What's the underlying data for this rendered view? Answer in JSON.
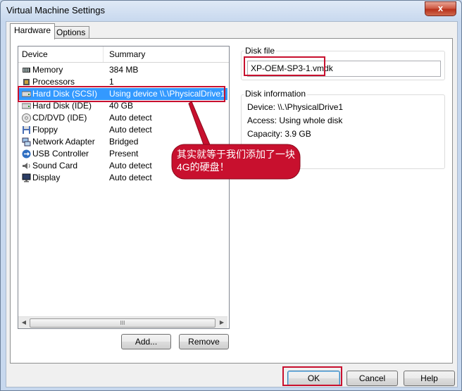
{
  "window": {
    "title": "Virtual Machine Settings",
    "close_label": "x"
  },
  "tabs": [
    {
      "label": "Hardware"
    },
    {
      "label": "Options"
    }
  ],
  "device_list": {
    "columns": {
      "device": "Device",
      "summary": "Summary"
    },
    "rows": [
      {
        "device": "Memory",
        "summary": "384 MB",
        "icon": "memory-icon"
      },
      {
        "device": "Processors",
        "summary": "1",
        "icon": "processor-icon"
      },
      {
        "device": "Hard Disk (SCSI)",
        "summary": "Using device \\\\.\\PhysicalDrive1",
        "icon": "hard-disk-icon",
        "selected": true
      },
      {
        "device": "Hard Disk (IDE)",
        "summary": "40 GB",
        "icon": "hard-disk-icon"
      },
      {
        "device": "CD/DVD (IDE)",
        "summary": "Auto detect",
        "icon": "cd-dvd-icon"
      },
      {
        "device": "Floppy",
        "summary": "Auto detect",
        "icon": "floppy-icon"
      },
      {
        "device": "Network Adapter",
        "summary": "Bridged",
        "icon": "network-icon"
      },
      {
        "device": "USB Controller",
        "summary": "Present",
        "icon": "usb-icon"
      },
      {
        "device": "Sound Card",
        "summary": "Auto detect",
        "icon": "sound-icon"
      },
      {
        "device": "Display",
        "summary": "Auto detect",
        "icon": "display-icon"
      }
    ],
    "scroll_thumb_label": "III"
  },
  "list_buttons": {
    "add": "Add...",
    "remove": "Remove"
  },
  "disk_file": {
    "label": "Disk file",
    "value": "XP-OEM-SP3-1.vmdk"
  },
  "disk_information": {
    "label": "Disk information",
    "device": "Device:  \\\\.\\PhysicalDrive1",
    "access": "Access:  Using whole disk",
    "capacity": "Capacity:  3.9 GB"
  },
  "annotation": {
    "text": "其实就等于我们添加了一块4G的硬盘！",
    "color": "#c8102e"
  },
  "dialog_buttons": {
    "ok": "OK",
    "cancel": "Cancel",
    "help": "Help"
  }
}
